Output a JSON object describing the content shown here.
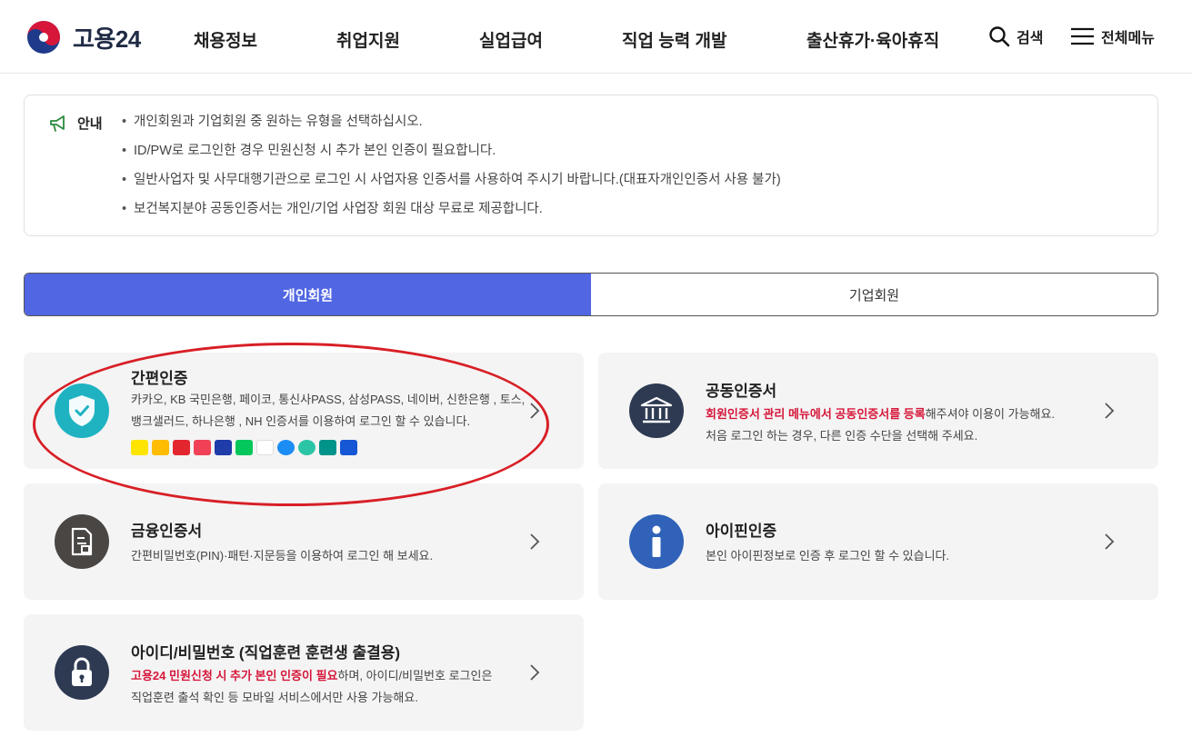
{
  "header": {
    "logo_text": "고용24",
    "nav": [
      "채용정보",
      "취업지원",
      "실업급여",
      "직업 능력 개발",
      "출산휴가·육아휴직"
    ],
    "search_label": "검색",
    "menu_label": "전체메뉴"
  },
  "notice": {
    "title": "안내",
    "items": [
      "개인회원과 기업회원 중 원하는 유형을 선택하십시오.",
      "ID/PW로 로그인한 경우 민원신청 시 추가 본인 인증이 필요합니다.",
      "일반사업자 및 사무대행기관으로 로그인 시 사업자용 인증서를 사용하여 주시기 바랍니다.(대표자개인인증서 사용 불가)",
      "보건복지분야 공동인증서는 개인/기업 사업장 회원 대상 무료로 제공합니다."
    ]
  },
  "tabs": {
    "personal": "개인회원",
    "business": "기업회원",
    "active": "personal"
  },
  "cards": {
    "simple": {
      "title": "간편인증",
      "line1": "카카오, KB 국민은행, 페이코, 통신사PASS, 삼성PASS, 네이버, 신한은행 , 토스,",
      "line2": "뱅크샐러드, 하나은행 , NH 인증서를 이용하여 로그인 할 수 있습니다.",
      "provider_icons": [
        "kakao-icon",
        "kb-icon",
        "payco-icon",
        "pass-icon",
        "samsung-pass-icon",
        "naver-icon",
        "shinhan-icon",
        "toss-icon",
        "banksalad-icon",
        "hana-icon",
        "nh-icon"
      ]
    },
    "joint": {
      "title": "공동인증서",
      "line1_red": "회원인증서 관리 메뉴에서 공동인증서를 등록",
      "line1_rest": "해주셔야 이용이 가능해요.",
      "line2": "처음 로그인 하는 경우, 다른 인증 수단을 선택해 주세요."
    },
    "financial": {
      "title": "금융인증서",
      "line1": "간편비밀번호(PIN)·패턴·지문등을 이용하여 로그인 해 보세요."
    },
    "ipin": {
      "title": "아이핀인증",
      "line1": "본인 아이핀정보로 인증 후 로그인 할 수 있습니다."
    },
    "idpw": {
      "title": "아이디/비밀번호 (직업훈련 훈련생 출결용)",
      "line1_red": "고용24 민원신청 시 추가 본인 인증이 필요",
      "line1_rest": "하며, 아이디/비밀번호 로그인은",
      "line2": "직업훈련 출석 확인 등 모바일 서비스에서만 사용 가능해요."
    }
  },
  "colors": {
    "tab_active": "#5066e3",
    "simple_icon": "#1fb3c2",
    "joint_icon": "#2e3a52",
    "financial_icon": "#4a4643",
    "ipin_icon": "#2f62b8",
    "idpw_icon": "#2e3a52",
    "highlight_red": "#d6173a",
    "annotation": "#d81f26"
  }
}
